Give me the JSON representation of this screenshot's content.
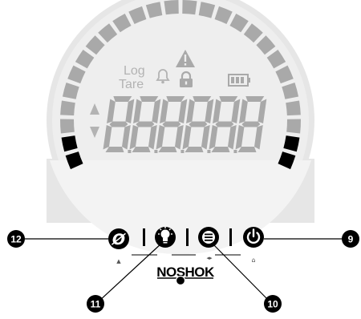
{
  "display": {
    "log_label": "Log",
    "tare_label": "Tare",
    "digits_text": "8.8.8.8.8.8",
    "segment_color": "#a9a9a9",
    "ring_color": "#e6e6e6",
    "bar_active_color": "#000000",
    "bar_inactive_color": "#a9a9a9",
    "bar_segments_inactive": 22,
    "bar_segments_active_each_side": 2
  },
  "buttons": [
    {
      "id": "zero",
      "icon": "zero-icon",
      "glyph": "Ø",
      "sub": "▲"
    },
    {
      "id": "light",
      "icon": "lightbulb-icon",
      "glyph": "",
      "sub": ""
    },
    {
      "id": "menu",
      "icon": "menu-icon",
      "glyph": "",
      "sub": "◂▸"
    },
    {
      "id": "power",
      "icon": "power-icon",
      "glyph": "",
      "sub": "⌂"
    }
  ],
  "callouts": [
    {
      "number": "12",
      "target": "zero-button"
    },
    {
      "number": "11",
      "target": "light-button"
    },
    {
      "number": "10",
      "target": "menu-button"
    },
    {
      "number": "9",
      "target": "power-button"
    }
  ],
  "brand": {
    "name": "NOSHOK"
  }
}
